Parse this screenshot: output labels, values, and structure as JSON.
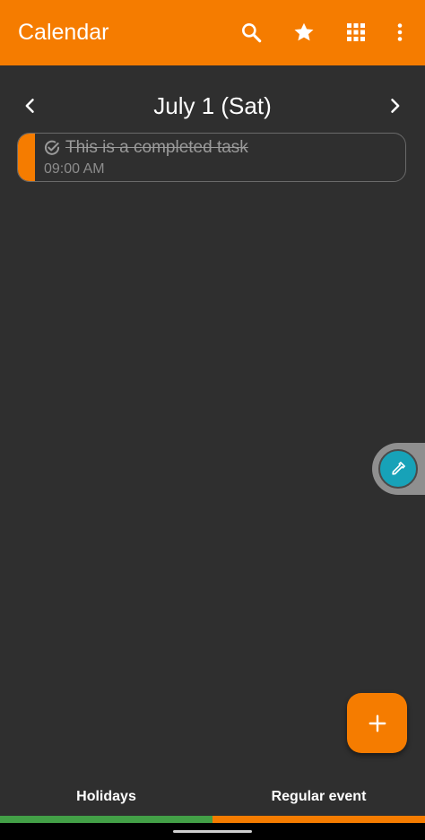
{
  "app_bar": {
    "title": "Calendar",
    "background": "#f57c00",
    "actions": [
      {
        "name": "search-icon"
      },
      {
        "name": "star-icon"
      },
      {
        "name": "grid-icon"
      },
      {
        "name": "more-vertical-icon"
      }
    ]
  },
  "date_nav": {
    "title": "July 1 (Sat)",
    "prev_icon": "chevron-left-icon",
    "next_icon": "chevron-right-icon"
  },
  "events": [
    {
      "title": "This is a completed task",
      "time": "09:00 AM",
      "completed": true,
      "color": "#f57c00",
      "icon": "check-circle-icon"
    }
  ],
  "side_handle": {
    "icon": "color-picker-icon",
    "color": "#17a2b8"
  },
  "fab": {
    "icon": "plus-icon",
    "color": "#f57c00"
  },
  "legend": [
    {
      "label": "Holidays",
      "color": "#43a047"
    },
    {
      "label": "Regular event",
      "color": "#f57c00"
    }
  ]
}
